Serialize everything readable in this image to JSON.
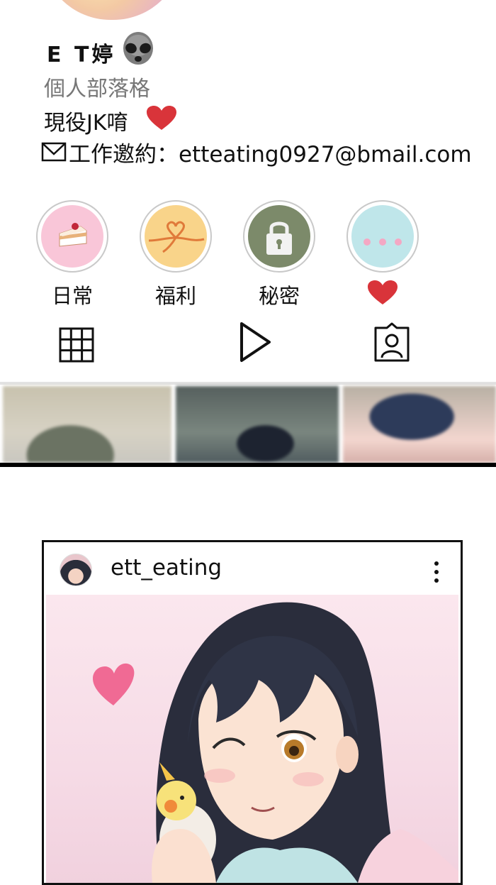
{
  "profile": {
    "name": "E T婷",
    "category": "個人部落格",
    "bio_line1": "現役JK唷",
    "bio_contact": "工作邀約：etteating0927@bmail.com"
  },
  "highlights": [
    {
      "label": "日常",
      "icon": "cake-icon",
      "color": "#f9c6d8"
    },
    {
      "label": "福利",
      "icon": "ribbon-heart-icon",
      "color": "#f9d48a"
    },
    {
      "label": "秘密",
      "icon": "lock-icon",
      "color": "#7c8a6a"
    },
    {
      "label": "",
      "icon": "heart-icon",
      "color": "#bfe6ea"
    }
  ],
  "tabs": [
    {
      "name": "grid",
      "icon": "grid-icon"
    },
    {
      "name": "reels",
      "icon": "play-icon"
    },
    {
      "name": "tagged",
      "icon": "tagged-person-icon"
    }
  ],
  "post": {
    "username": "ett_eating"
  },
  "colors": {
    "heart": "#d9343a",
    "pink_heart": "#f06a94"
  }
}
